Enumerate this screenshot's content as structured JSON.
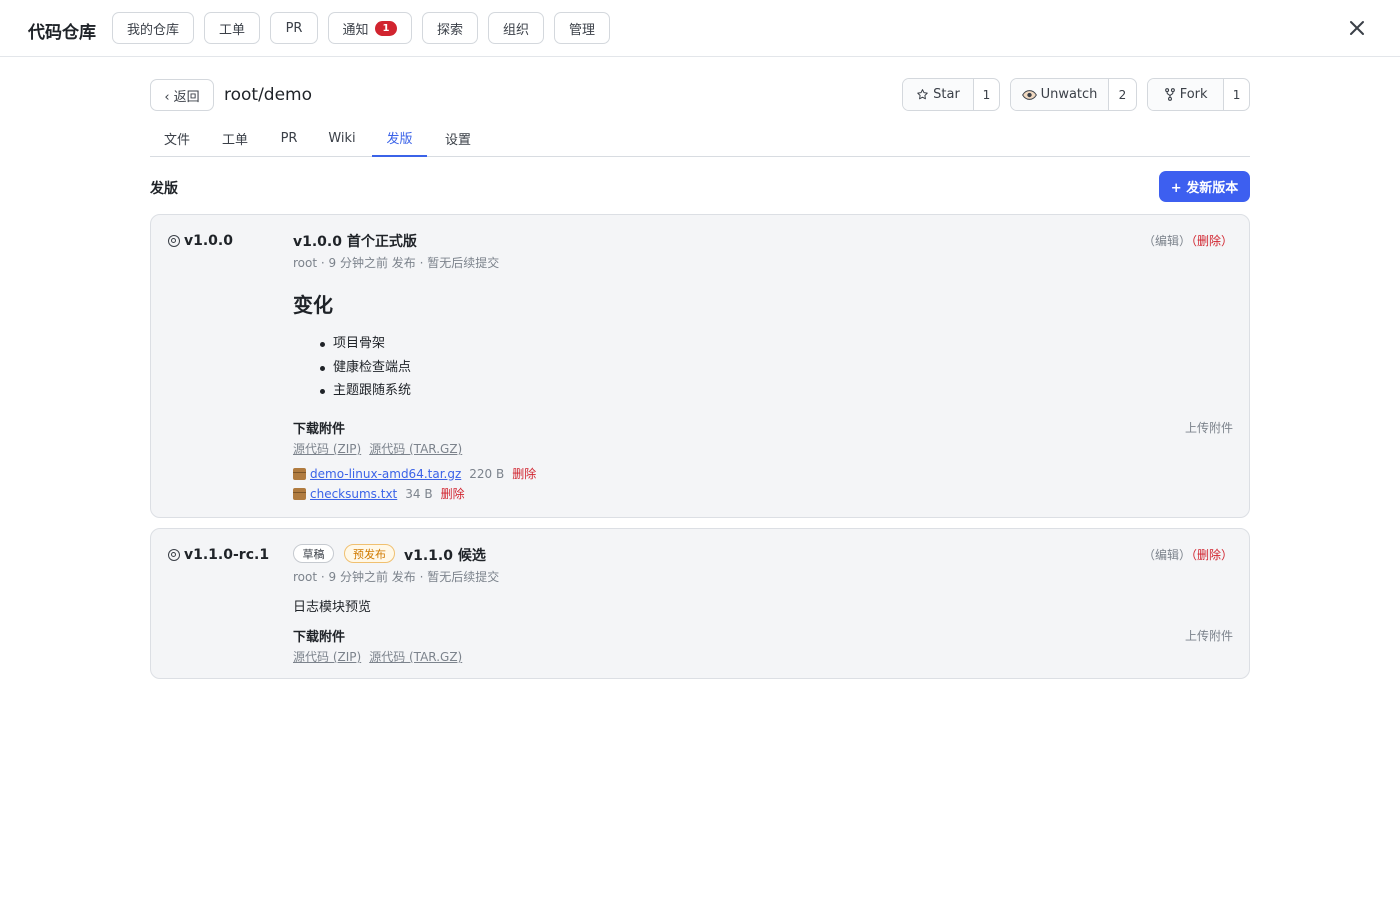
{
  "app": {
    "brand": "代码仓库",
    "nav": [
      {
        "label": "我的仓库"
      },
      {
        "label": "工单"
      },
      {
        "label": "PR"
      },
      {
        "label": "通知",
        "badge": "1"
      },
      {
        "label": "探索"
      },
      {
        "label": "组织"
      },
      {
        "label": "管理"
      }
    ],
    "close_icon": "close-icon"
  },
  "repo": {
    "back_label": "‹ 返回",
    "name": "root/demo",
    "star": {
      "label": "Star",
      "icon": "star-icon",
      "count": "1"
    },
    "watch": {
      "label": "Unwatch",
      "icon": "eye-icon",
      "count": "2"
    },
    "fork": {
      "label": "Fork",
      "icon": "fork-icon",
      "count": "1"
    }
  },
  "tabs": [
    {
      "label": "文件"
    },
    {
      "label": "工单"
    },
    {
      "label": "PR"
    },
    {
      "label": "Wiki"
    },
    {
      "label": "发版",
      "active": true
    },
    {
      "label": "设置"
    }
  ],
  "releases_section": {
    "title": "发版",
    "new_button": "+ 发新版本"
  },
  "releases": [
    {
      "tag": "v1.0.0",
      "title": "v1.0.0 首个正式版",
      "meta": "root · 9 分钟之前 发布 · 暂无后续提交",
      "edit": "（编辑）",
      "delete": "（删除）",
      "heading": "变化",
      "bullets": [
        "项目骨架",
        "健康检查端点",
        "主题跟随系统"
      ],
      "downloads_title": "下载附件",
      "upload": "上传附件",
      "source_zip": "源代码 (ZIP)",
      "source_tar": "源代码 (TAR.GZ)",
      "assets": [
        {
          "name": "demo-linux-amd64.tar.gz",
          "size": "220 B",
          "delete": "删除"
        },
        {
          "name": "checksums.txt",
          "size": "34 B",
          "delete": "删除"
        }
      ]
    },
    {
      "tag": "v1.1.0-rc.1",
      "draft_label": "草稿",
      "prerelease_label": "预发布",
      "title": "v1.1.0 候选",
      "meta": "root · 9 分钟之前 发布 · 暂无后续提交",
      "edit": "（编辑）",
      "delete": "（删除）",
      "body": "日志模块预览",
      "downloads_title": "下载附件",
      "upload": "上传附件",
      "source_zip": "源代码 (ZIP)",
      "source_tar": "源代码 (TAR.GZ)"
    }
  ],
  "colors": {
    "accent": "#3d5ff0",
    "danger": "#d1242f",
    "prerelease": "#d07a00"
  }
}
